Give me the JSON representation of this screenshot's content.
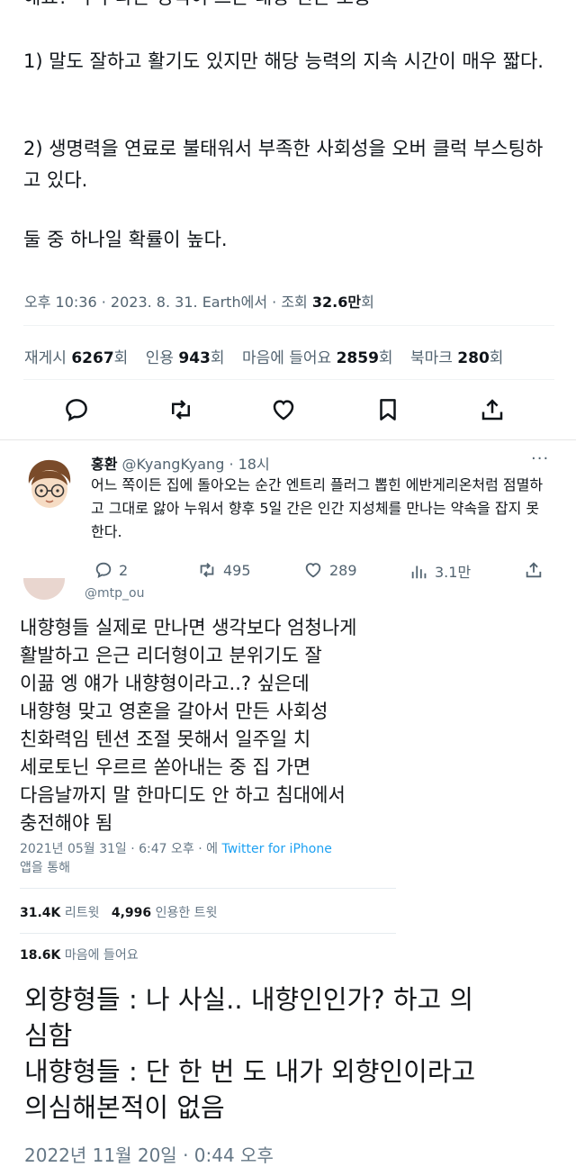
{
  "tweet_main": {
    "cutoff_line": "해요? 각각 다른 경역이 드는 내향 인은 보통",
    "paragraph1": "1) 말도 잘하고 활기도 있지만 해당 능력의 지속 시간이 매우 짧다.",
    "paragraph2": "2) 생명력을 연료로 불태워서 부족한 사회성을 오버 클럭 부스팅하고 있다.",
    "paragraph3": "둘 중 하나일 확률이 높다.",
    "meta": {
      "time": "오후 10:36",
      "date": "2023. 8. 31.",
      "source": "Earth에서",
      "views_label": "조회",
      "views_value": "32.6만",
      "views_suffix": "회"
    },
    "stats": {
      "retweets_label": "재게시",
      "retweets_value": "6267",
      "retweets_suffix": "회",
      "quotes_label": "인용",
      "quotes_value": "943",
      "quotes_suffix": "회",
      "likes_label": "마음에 들어요",
      "likes_value": "2859",
      "likes_suffix": "회",
      "bookmarks_label": "북마크",
      "bookmarks_value": "280",
      "bookmarks_suffix": "회"
    }
  },
  "reply": {
    "name": "홍환",
    "handle": "@KyangKyang",
    "time": "18시",
    "text": "어느 쪽이든 집에 돌아오는 순간 엔트리 플러그 뽑힌 에반게리온처럼 점멸하고 그대로 앓아 누워서 향후 5일 간은 인간 지성체를 만나는 약속을 잡지 못한다.",
    "replies": "2",
    "retweets": "495",
    "likes": "289",
    "views": "3.1만"
  },
  "old_tweet": {
    "handle_cut": "@mtp_ou",
    "text": "내향형들 실제로 만나면 생각보다 엄청나게\n활발하고 은근 리더형이고 분위기도 잘\n이끎 엥 얘가 내향형이라고..? 싶은데\n내향형 맞고 영혼을 갈아서 만든 사회성\n친화력임 텐션 조절 못해서 일주일 치\n세로토닌 우르르 쏟아내는 중 집 가면\n다음날까지 말 한마디도 안 하고 침대에서\n충전해야 됨",
    "date": "2021년 05월 31일 · 6:47 오후 · 에",
    "client": "Twitter for iPhone",
    "via": "앱을 통해",
    "retweets_value": "31.4K",
    "retweets_label": "리트윗",
    "quotes_value": "4,996",
    "quotes_label": "인용한 트윗",
    "likes_value": "18.6K",
    "likes_label": "마음에 들어요"
  },
  "big_text": {
    "text": "외향형들 : 나 사실.. 내향인인가? 하고 의\n심함\n내향형들 : 단 한 번 도 내가 외향인이라고\n의심해본적이 없음",
    "cut_bottom": "2022년 11월 20일 · 0:44 오후"
  },
  "colors": {
    "text_primary": "#0f1419",
    "text_secondary": "#536471",
    "twitter_blue": "#1da1f2"
  }
}
